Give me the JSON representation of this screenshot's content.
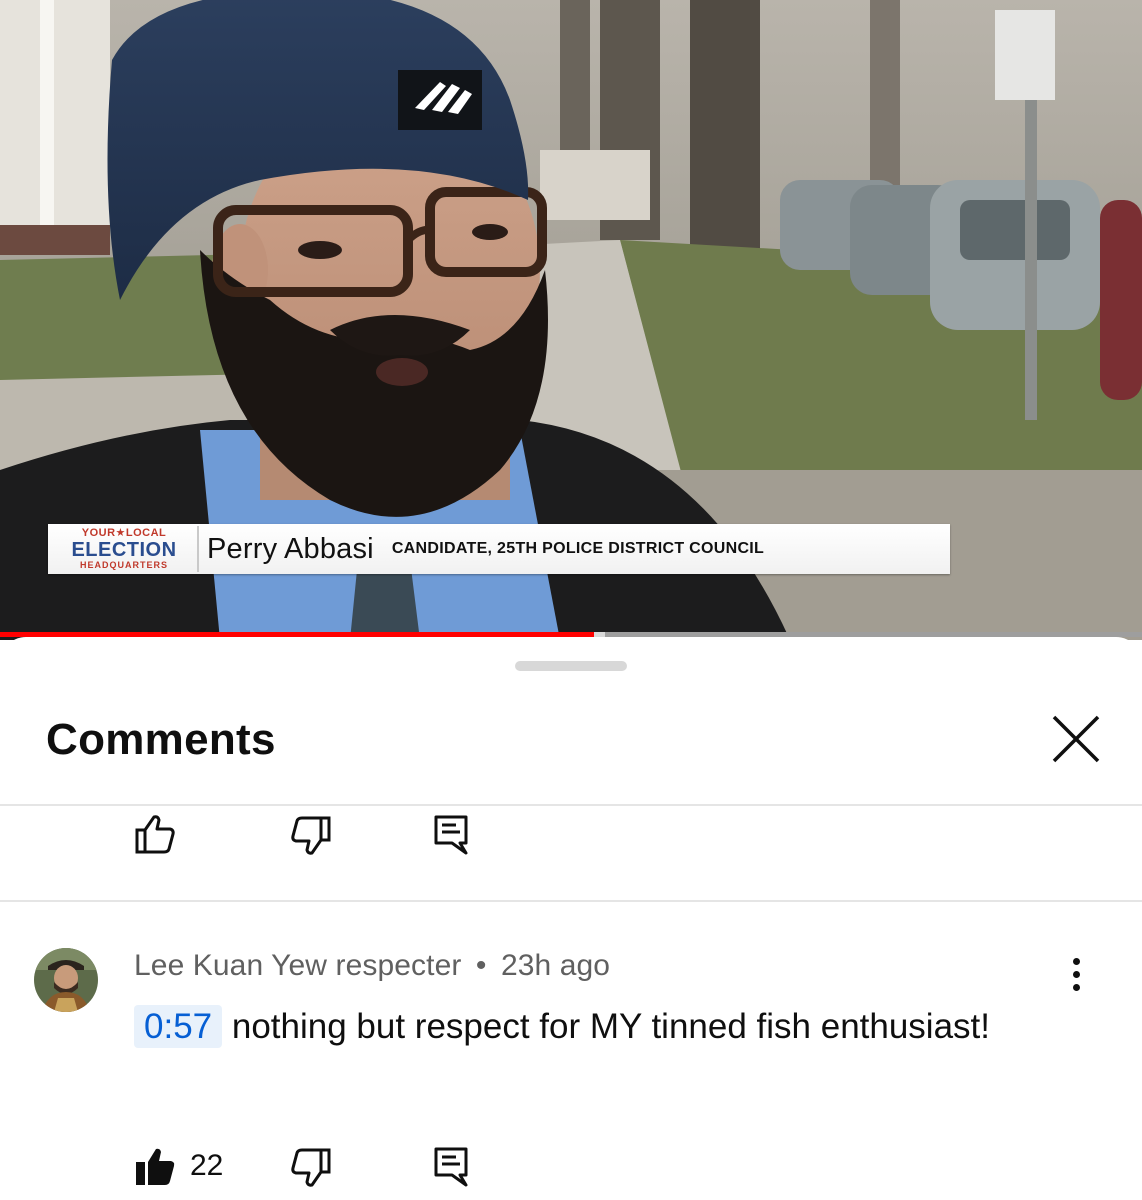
{
  "video": {
    "lower_third": {
      "logo": {
        "line1": "YOUR★LOCAL",
        "line2": "ELECTION",
        "line3": "HEADQUARTERS"
      },
      "name": "Perry Abbasi",
      "title": "CANDIDATE, 25TH POLICE DISTRICT COUNCIL"
    },
    "hat_brand": "adidas",
    "progress_fraction": 0.52,
    "buffered_fraction": 0.53
  },
  "comments_panel": {
    "title": "Comments",
    "close_icon": "close-icon",
    "previous_comment_actions": {
      "like_icon": "thumbs-up-outline-icon",
      "dislike_icon": "thumbs-down-outline-icon",
      "reply_icon": "reply-icon"
    },
    "comment": {
      "author": "Lee Kuan Yew respecter",
      "separator": "•",
      "time": "23h ago",
      "timestamp_link": "0:57",
      "text": "nothing but respect for MY tinned fish enthusiast!",
      "like_count": "22",
      "like_icon": "thumbs-up-filled-icon",
      "dislike_icon": "thumbs-down-outline-icon",
      "reply_icon": "reply-icon",
      "menu_icon": "more-vertical-icon"
    }
  },
  "colors": {
    "progress": "#ff0000",
    "link": "#065fd4",
    "link_bg": "#e8f1fb",
    "meta_text": "#606060"
  }
}
